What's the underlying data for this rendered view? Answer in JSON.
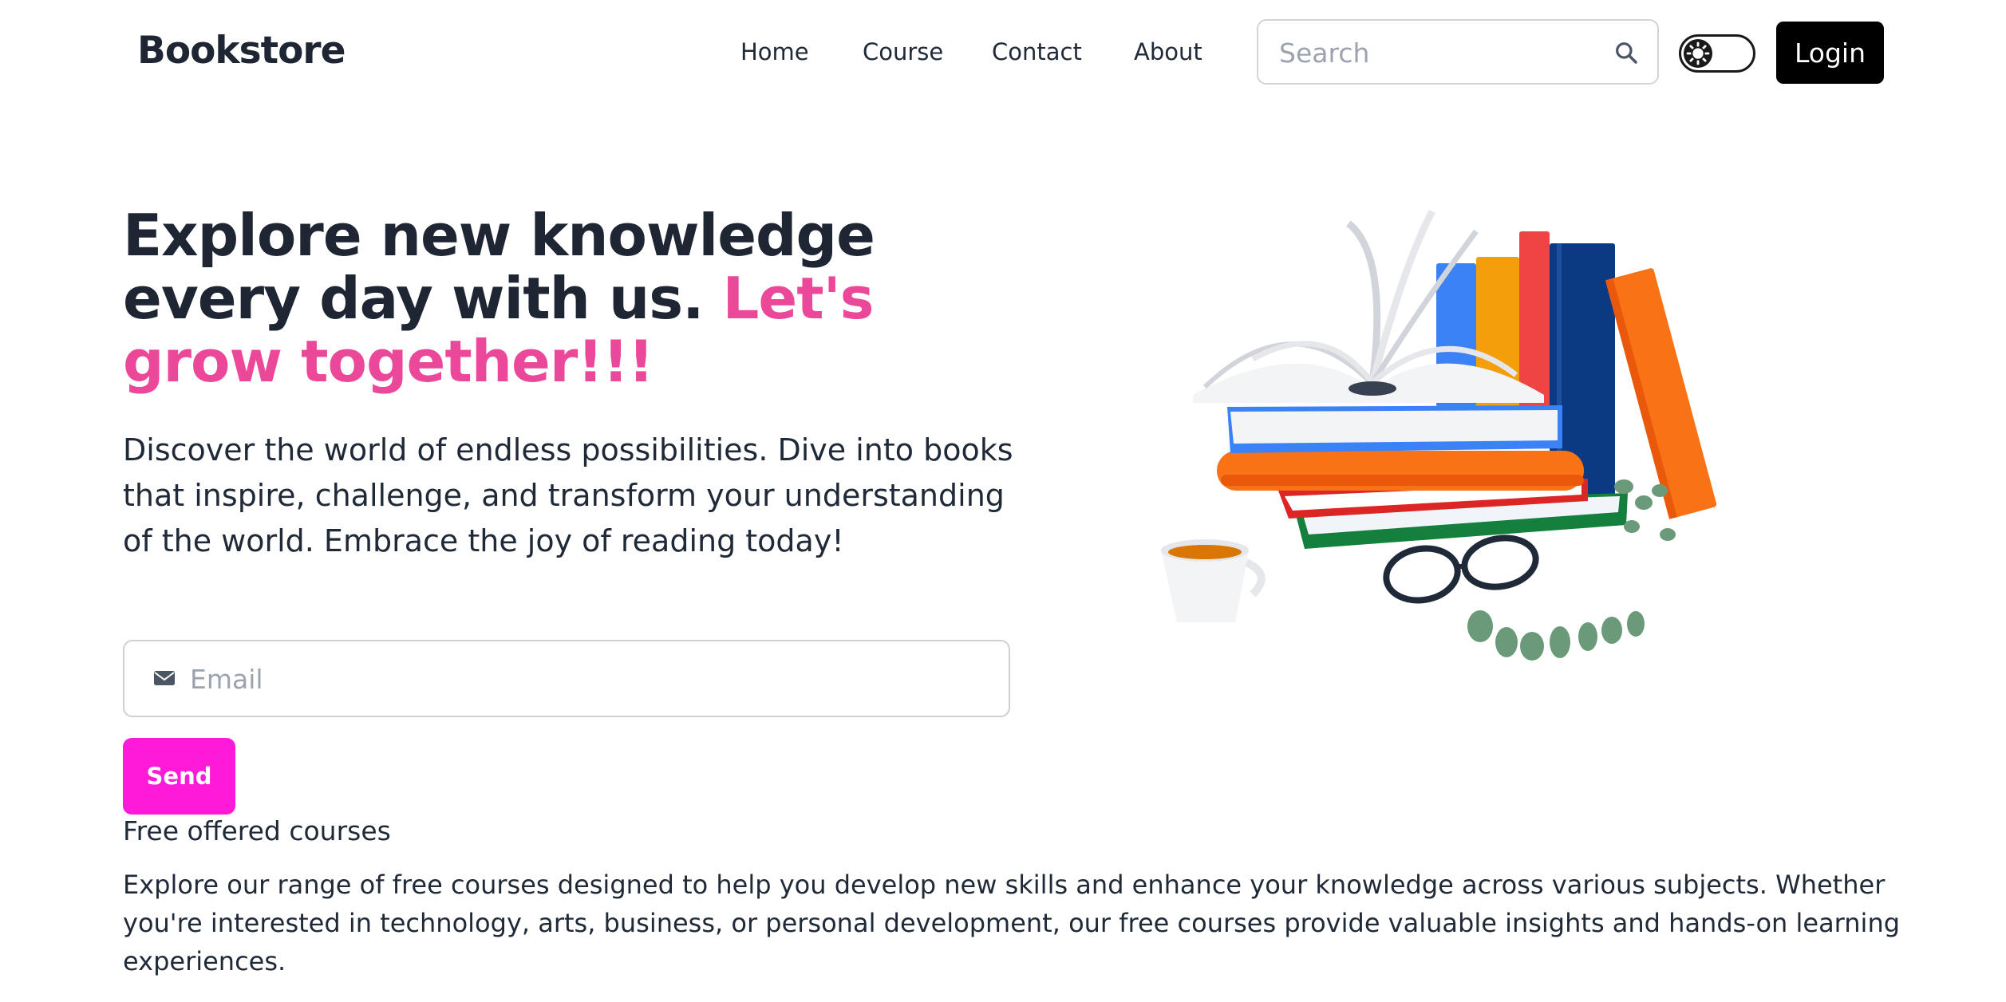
{
  "navbar": {
    "brand": "Bookstore",
    "links": [
      "Home",
      "Course",
      "Contact",
      "About"
    ],
    "search": {
      "placeholder": "Search",
      "icon": "search-icon"
    },
    "theme_toggle": {
      "icon": "sun-icon"
    },
    "login_label": "Login"
  },
  "hero": {
    "title_main": "Explore new knowledge every day with us. ",
    "title_accent": "Let's grow together!!!",
    "description": "Discover the world of endless possibilities. Dive into books that inspire, challenge, and transform your understanding of the world. Embrace the joy of reading today!",
    "email": {
      "placeholder": "Email",
      "icon": "envelope-icon"
    },
    "send_label": "Send"
  },
  "courses": {
    "heading": "Free offered courses",
    "description": "Explore our range of free courses designed to help you develop new skills and enhance your knowledge across various subjects. Whether you're interested in technology, arts, business, or personal development, our free courses provide valuable insights and hands-on learning experiences."
  },
  "colors": {
    "accent": "#ec4899",
    "send_button": "#ff1ad9",
    "login_button": "#000000",
    "text": "#1f2937"
  }
}
